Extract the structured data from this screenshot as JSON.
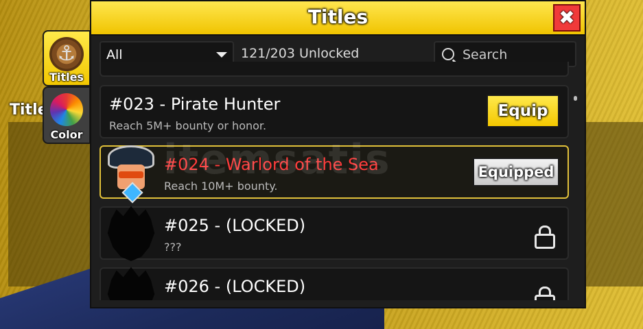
{
  "background": {
    "side_label": "Title"
  },
  "side_tabs": [
    {
      "label": "Titles",
      "icon": "anchor-icon",
      "active": true
    },
    {
      "label": "Color",
      "icon": "color-wheel-icon",
      "active": false
    }
  ],
  "window": {
    "title": "Titles",
    "close_glyph": "✖"
  },
  "toolbar": {
    "filter_value": "All",
    "unlock_count": "121/203 Unlocked",
    "search_placeholder": "Search"
  },
  "titles": [
    {
      "title": "#023 - Pirate Hunter",
      "desc": "Reach 5M+ bounty or honor.",
      "state": "unlocked",
      "action": "Equip"
    },
    {
      "title": "#024 - Warlord of the Sea",
      "desc": "Reach 10M+ bounty.",
      "state": "equipped",
      "action": "Equipped"
    },
    {
      "title": "#025 - (LOCKED)",
      "desc": "???",
      "state": "locked"
    },
    {
      "title": "#026 - (LOCKED)",
      "desc": "",
      "state": "locked"
    }
  ],
  "watermark": "itemsatis",
  "colors": {
    "accent_yellow": "#f4c800",
    "equipped_title_red": "#ff3b3b",
    "close_red": "#f03a3a"
  }
}
